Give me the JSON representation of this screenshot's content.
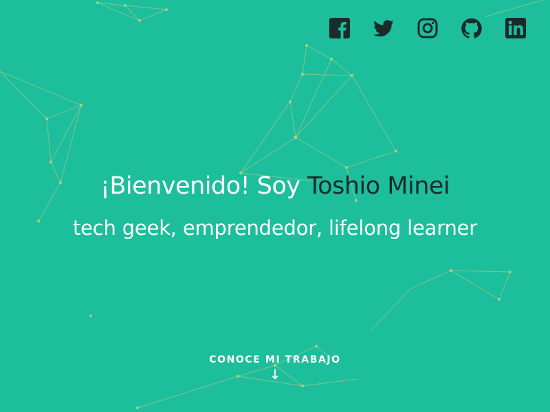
{
  "social": [
    {
      "name": "facebook-icon"
    },
    {
      "name": "twitter-icon"
    },
    {
      "name": "instagram-icon"
    },
    {
      "name": "github-icon"
    },
    {
      "name": "linkedin-icon"
    }
  ],
  "colors": {
    "background": "#1dbe9c",
    "icon": "#1b2b2a",
    "name_highlight": "#1b2b2a",
    "network_lines": "#d7cf7e"
  },
  "hero": {
    "greeting": "¡Bienvenido! Soy",
    "name": "Toshio Minei",
    "subtitle": "tech geek, emprendedor, lifelong learner"
  },
  "cta": {
    "label": "CONOCE MI TRABAJO",
    "arrow": "↓"
  }
}
